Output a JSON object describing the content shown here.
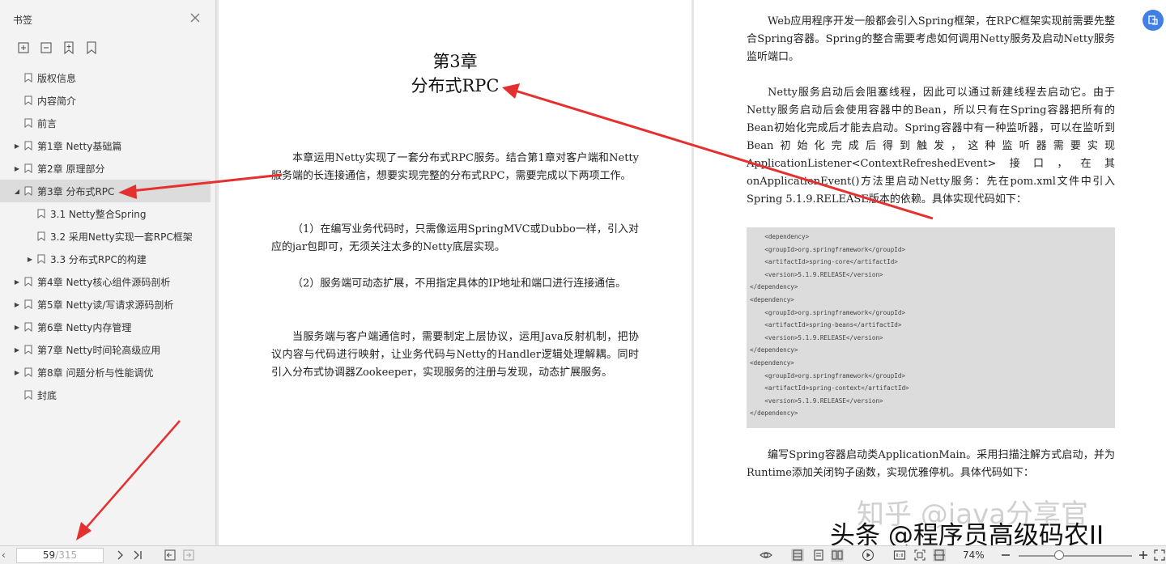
{
  "sidebar": {
    "title": "书签",
    "items": [
      {
        "label": "版权信息",
        "level": 0,
        "expandable": false,
        "expanded": false,
        "selected": false
      },
      {
        "label": "内容简介",
        "level": 0,
        "expandable": false,
        "expanded": false,
        "selected": false
      },
      {
        "label": "前言",
        "level": 0,
        "expandable": false,
        "expanded": false,
        "selected": false
      },
      {
        "label": "第1章 Netty基础篇",
        "level": 0,
        "expandable": true,
        "expanded": false,
        "selected": false
      },
      {
        "label": "第2章 原理部分",
        "level": 0,
        "expandable": true,
        "expanded": false,
        "selected": false
      },
      {
        "label": "第3章 分布式RPC",
        "level": 0,
        "expandable": true,
        "expanded": true,
        "selected": true
      },
      {
        "label": "3.1 Netty整合Spring",
        "level": 1,
        "expandable": false,
        "expanded": false,
        "selected": false
      },
      {
        "label": "3.2 采用Netty实现一套RPC框架",
        "level": 1,
        "expandable": false,
        "expanded": false,
        "selected": false
      },
      {
        "label": "3.3 分布式RPC的构建",
        "level": 1,
        "expandable": true,
        "expanded": false,
        "selected": false
      },
      {
        "label": "第4章 Netty核心组件源码剖析",
        "level": 0,
        "expandable": true,
        "expanded": false,
        "selected": false
      },
      {
        "label": "第5章 Netty读/写请求源码剖析",
        "level": 0,
        "expandable": true,
        "expanded": false,
        "selected": false
      },
      {
        "label": "第6章 Netty内存管理",
        "level": 0,
        "expandable": true,
        "expanded": false,
        "selected": false
      },
      {
        "label": "第7章 Netty时间轮高级应用",
        "level": 0,
        "expandable": true,
        "expanded": false,
        "selected": false
      },
      {
        "label": "第8章 问题分析与性能调优",
        "level": 0,
        "expandable": true,
        "expanded": false,
        "selected": false
      },
      {
        "label": "封底",
        "level": 0,
        "expandable": false,
        "expanded": false,
        "selected": false
      }
    ]
  },
  "left_page": {
    "chapter_num": "第3章",
    "chapter_title": "分布式RPC",
    "paragraphs": [
      "本章运用Netty实现了一套分布式RPC服务。结合第1章对客户端和Netty服务端的长连接通信，想要实现完整的分布式RPC，需要完成以下两项工作。",
      "（1）在编写业务代码时，只需像运用SpringMVC或Dubbo一样，引入对应的jar包即可，无须关注太多的Netty底层实现。",
      "（2）服务端可动态扩展，不用指定具体的IP地址和端口进行连接通信。",
      "当服务端与客户端通信时，需要制定上层协议，运用Java反射机制，把协议内容与代码进行映射，让业务代码与Netty的Handler逻辑处理解耦。同时引入分布式协调器Zookeeper，实现服务的注册与发现，动态扩展服务。"
    ]
  },
  "right_page": {
    "paragraphs": [
      "Web应用程序开发一般都会引入Spring框架，在RPC框架实现前需要先整合Spring容器。Spring的整合需要考虑如何调用Netty服务及启动Netty服务监听端口。",
      "Netty服务启动后会阻塞线程，因此可以通过新建线程去启动它。由于Netty服务启动后会使用容器中的Bean，所以只有在Spring容器把所有的Bean初始化完成后才能去启动。Spring容器中有一种监听器，可以在监听到Bean初始化完成后得到触发，这种监听器需要实现ApplicationListener<ContextRefreshedEvent>接口，在其onApplicationEvent()方法里启动Netty服务：先在pom.xml文件中引入Spring 5.1.9.RELEASE版本的依赖。具体实现代码如下：",
      "编写Spring容器启动类ApplicationMain。采用扫描注解方式启动，并为Runtime添加关闭钩子函数，实现优雅停机。具体代码如下："
    ],
    "code": "    <dependency>\n    <groupId>org.springframework</groupId>\n    <artifactId>spring-core</artifactId>\n    <version>5.1.9.RELEASE</version>\n</dependency>\n<dependency>\n    <groupId>org.springframework</groupId>\n    <artifactId>spring-beans</artifactId>\n    <version>5.1.9.RELEASE</version>\n</dependency>\n<dependency>\n    <groupId>org.springframework</groupId>\n    <artifactId>spring-context</artifactId>\n    <version>5.1.9.RELEASE</version>\n</dependency>"
  },
  "statusbar": {
    "current_page": "59",
    "total_pages": "/315",
    "zoom": "74%"
  },
  "watermark": {
    "zhihu": "知乎 @java分享官",
    "toutiao": "头条 @程序员高级码农II"
  },
  "colors": {
    "accent": "#3f7fe6",
    "annotation_arrow": "#e53030"
  }
}
